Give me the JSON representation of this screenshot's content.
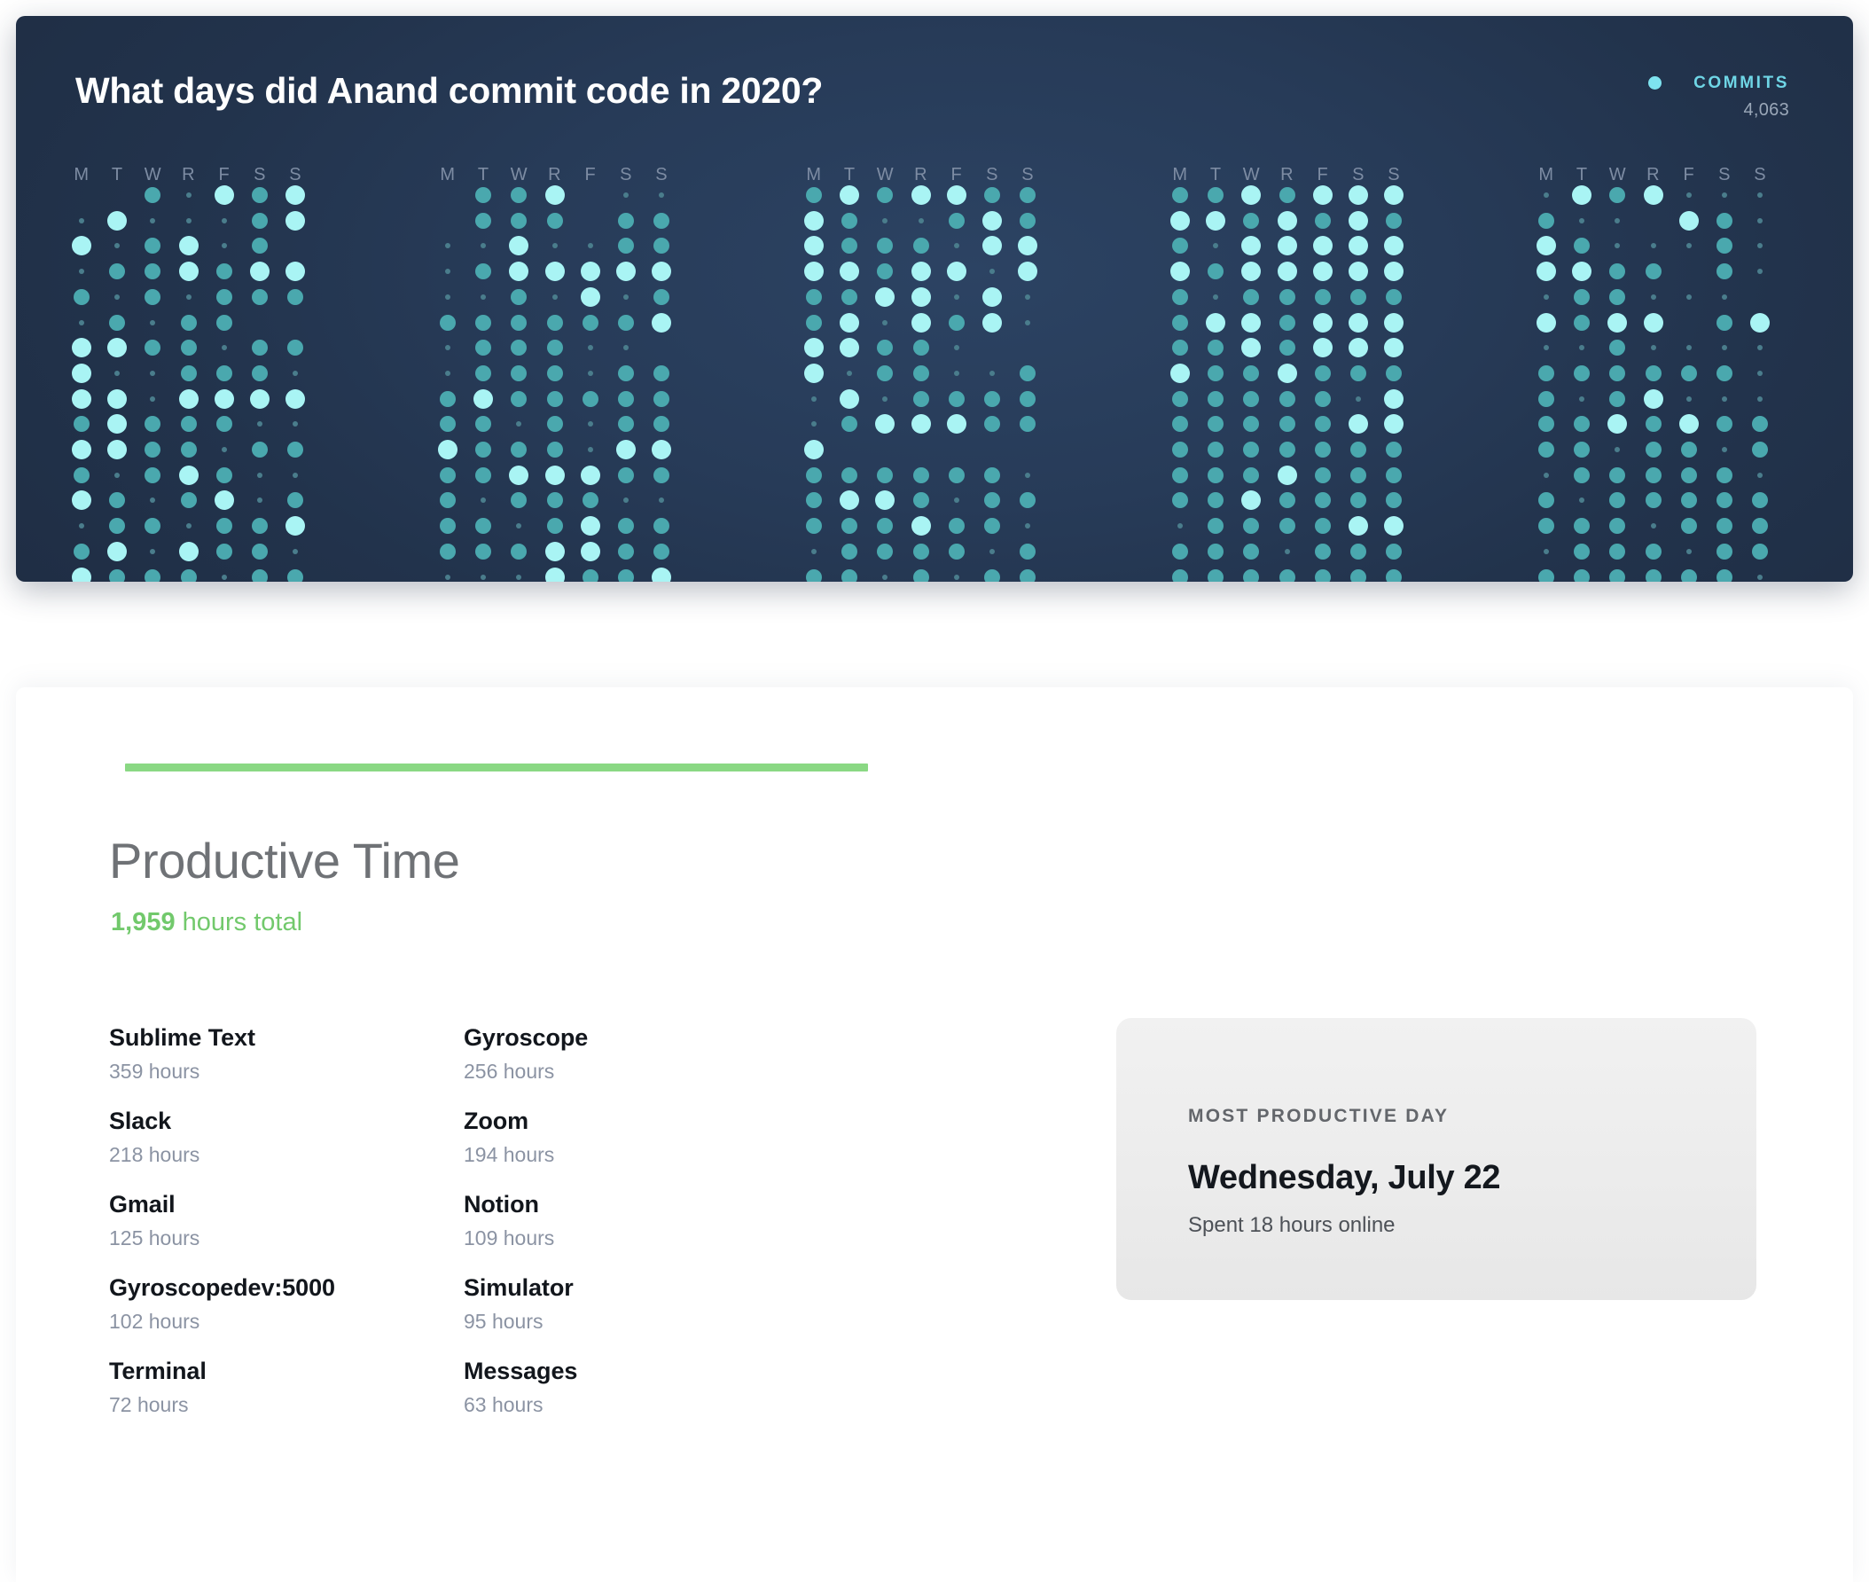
{
  "commits_panel": {
    "title": "What days did Anand commit code in 2020?",
    "legend": {
      "label": "COMMITS",
      "value": "4,063",
      "dot_color": "#7ee3ef"
    },
    "day_labels": [
      "M",
      "T",
      "W",
      "R",
      "F",
      "S",
      "S"
    ],
    "background_color": "#24364f"
  },
  "productive_time": {
    "accent_color": "#8ad884",
    "title": "Productive Time",
    "total_value": "1,959",
    "total_suffix": " hours total",
    "apps_column_1": [
      {
        "name": "Sublime Text",
        "hours": "359 hours"
      },
      {
        "name": "Slack",
        "hours": "218 hours"
      },
      {
        "name": "Gmail",
        "hours": "125 hours"
      },
      {
        "name": "Gyroscopedev:5000",
        "hours": "102 hours"
      },
      {
        "name": "Terminal",
        "hours": "72 hours"
      }
    ],
    "apps_column_2": [
      {
        "name": "Gyroscope",
        "hours": "256 hours"
      },
      {
        "name": "Zoom",
        "hours": "194 hours"
      },
      {
        "name": "Notion",
        "hours": "109 hours"
      },
      {
        "name": "Simulator",
        "hours": "95 hours"
      },
      {
        "name": "Messages",
        "hours": "63 hours"
      }
    ]
  },
  "most_productive_day": {
    "label": "MOST PRODUCTIVE DAY",
    "day": "Wednesday, July 22",
    "note": "Spent 18 hours online"
  },
  "chart_data": {
    "type": "heatmap",
    "title": "What days did Anand commit code in 2020?",
    "legend_entries": [
      {
        "name": "COMMITS",
        "total": 4063,
        "color": "#7ee3ef"
      }
    ],
    "xlabel": "",
    "ylabel": "",
    "grid": false,
    "legend_position": "top-right",
    "encoding": "dot radius and brightness encode commits per day; 0 = absent, 4 = max",
    "day_labels": [
      "M",
      "T",
      "W",
      "R",
      "F",
      "S",
      "S"
    ],
    "blocks": 5,
    "rows_per_block": 16,
    "levels": [
      {
        "level": 0,
        "radius": 0,
        "color": "none"
      },
      {
        "level": 1,
        "radius": 3,
        "color": "#4a7d8c"
      },
      {
        "level": 2,
        "radius": 6,
        "color": "#45919b"
      },
      {
        "level": 3,
        "radius": 9,
        "color": "#4aa8ae"
      },
      {
        "level": 4,
        "radius": 11,
        "color": "#a9f4f4"
      }
    ],
    "values": [
      [
        [
          0,
          0,
          3,
          1,
          4,
          3,
          4
        ],
        [
          1,
          4,
          1,
          1,
          1,
          3,
          4
        ],
        [
          4,
          1,
          3,
          4,
          1,
          3,
          0
        ],
        [
          1,
          3,
          3,
          4,
          3,
          4,
          4
        ],
        [
          3,
          1,
          3,
          1,
          3,
          3,
          3
        ],
        [
          1,
          3,
          1,
          3,
          3,
          0,
          0
        ],
        [
          4,
          4,
          3,
          3,
          1,
          3,
          3
        ],
        [
          4,
          1,
          1,
          3,
          3,
          3,
          1
        ],
        [
          4,
          4,
          1,
          4,
          4,
          4,
          4
        ],
        [
          3,
          4,
          3,
          3,
          3,
          1,
          1
        ],
        [
          4,
          4,
          3,
          3,
          1,
          3,
          3
        ],
        [
          3,
          1,
          3,
          4,
          3,
          1,
          1
        ],
        [
          4,
          3,
          1,
          3,
          4,
          1,
          3
        ],
        [
          1,
          3,
          3,
          1,
          3,
          3,
          4
        ],
        [
          3,
          4,
          1,
          4,
          3,
          3,
          1
        ],
        [
          4,
          3,
          3,
          3,
          1,
          3,
          3
        ]
      ],
      [
        [
          0,
          3,
          3,
          4,
          0,
          1,
          1
        ],
        [
          0,
          3,
          3,
          3,
          0,
          3,
          3
        ],
        [
          1,
          1,
          4,
          1,
          1,
          3,
          3
        ],
        [
          1,
          3,
          4,
          4,
          4,
          4,
          4
        ],
        [
          1,
          1,
          3,
          1,
          4,
          1,
          3
        ],
        [
          3,
          3,
          3,
          3,
          3,
          3,
          4
        ],
        [
          1,
          3,
          3,
          3,
          1,
          1,
          0
        ],
        [
          1,
          3,
          3,
          3,
          1,
          3,
          3
        ],
        [
          3,
          4,
          3,
          3,
          3,
          3,
          3
        ],
        [
          3,
          3,
          1,
          3,
          1,
          3,
          3
        ],
        [
          4,
          3,
          3,
          3,
          1,
          4,
          4
        ],
        [
          3,
          3,
          4,
          4,
          4,
          3,
          3
        ],
        [
          3,
          1,
          3,
          3,
          3,
          1,
          1
        ],
        [
          3,
          3,
          1,
          3,
          4,
          3,
          3
        ],
        [
          3,
          3,
          3,
          4,
          4,
          3,
          3
        ],
        [
          1,
          1,
          1,
          4,
          3,
          3,
          4
        ]
      ],
      [
        [
          3,
          4,
          3,
          4,
          4,
          3,
          3
        ],
        [
          4,
          3,
          1,
          1,
          3,
          4,
          3
        ],
        [
          4,
          3,
          3,
          3,
          1,
          4,
          4
        ],
        [
          4,
          4,
          3,
          4,
          4,
          1,
          4
        ],
        [
          3,
          3,
          4,
          4,
          1,
          4,
          1
        ],
        [
          3,
          4,
          1,
          4,
          3,
          4,
          1
        ],
        [
          4,
          4,
          3,
          3,
          1,
          0,
          0
        ],
        [
          4,
          1,
          3,
          3,
          1,
          1,
          3
        ],
        [
          1,
          4,
          1,
          3,
          3,
          3,
          3
        ],
        [
          1,
          3,
          4,
          4,
          4,
          3,
          3
        ],
        [
          4,
          0,
          0,
          0,
          0,
          0,
          0
        ],
        [
          3,
          3,
          3,
          3,
          3,
          3,
          1
        ],
        [
          3,
          4,
          4,
          3,
          1,
          3,
          3
        ],
        [
          3,
          3,
          3,
          4,
          3,
          3,
          1
        ],
        [
          1,
          3,
          3,
          3,
          3,
          1,
          3
        ],
        [
          3,
          3,
          1,
          3,
          1,
          3,
          3
        ]
      ],
      [
        [
          3,
          3,
          4,
          3,
          4,
          4,
          4
        ],
        [
          4,
          4,
          3,
          4,
          3,
          4,
          3
        ],
        [
          3,
          1,
          4,
          4,
          4,
          4,
          4
        ],
        [
          4,
          3,
          4,
          4,
          4,
          4,
          4
        ],
        [
          3,
          1,
          3,
          3,
          3,
          3,
          3
        ],
        [
          3,
          4,
          4,
          3,
          4,
          4,
          4
        ],
        [
          3,
          3,
          4,
          3,
          4,
          4,
          4
        ],
        [
          4,
          3,
          3,
          4,
          3,
          3,
          3
        ],
        [
          3,
          3,
          3,
          3,
          3,
          1,
          4
        ],
        [
          3,
          3,
          3,
          3,
          3,
          4,
          4
        ],
        [
          3,
          3,
          3,
          3,
          3,
          3,
          3
        ],
        [
          3,
          3,
          3,
          4,
          3,
          3,
          3
        ],
        [
          3,
          3,
          4,
          3,
          3,
          3,
          3
        ],
        [
          1,
          3,
          3,
          3,
          3,
          4,
          4
        ],
        [
          3,
          3,
          3,
          1,
          3,
          3,
          3
        ],
        [
          3,
          3,
          3,
          3,
          3,
          3,
          3
        ]
      ],
      [
        [
          1,
          4,
          3,
          4,
          1,
          1,
          1
        ],
        [
          3,
          1,
          1,
          0,
          4,
          3,
          1
        ],
        [
          4,
          3,
          1,
          1,
          1,
          3,
          1
        ],
        [
          4,
          4,
          3,
          3,
          0,
          3,
          1
        ],
        [
          1,
          3,
          3,
          1,
          1,
          1,
          0
        ],
        [
          4,
          3,
          4,
          4,
          0,
          3,
          4
        ],
        [
          1,
          1,
          3,
          1,
          1,
          1,
          1
        ],
        [
          3,
          3,
          3,
          3,
          3,
          3,
          1
        ],
        [
          3,
          1,
          3,
          4,
          1,
          1,
          1
        ],
        [
          3,
          3,
          4,
          3,
          4,
          3,
          3
        ],
        [
          3,
          3,
          1,
          3,
          3,
          1,
          3
        ],
        [
          1,
          3,
          3,
          3,
          3,
          3,
          1
        ],
        [
          3,
          1,
          3,
          3,
          3,
          3,
          3
        ],
        [
          3,
          3,
          3,
          1,
          3,
          3,
          3
        ],
        [
          1,
          3,
          3,
          3,
          1,
          3,
          3
        ],
        [
          3,
          3,
          3,
          3,
          3,
          3,
          1
        ]
      ]
    ]
  }
}
